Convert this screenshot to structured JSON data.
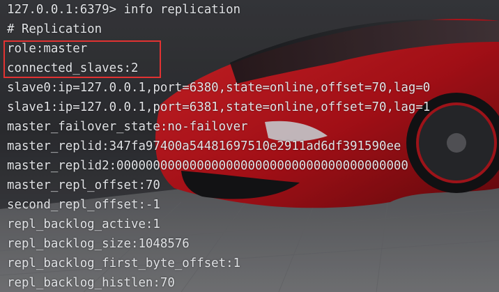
{
  "terminal": {
    "lines": [
      "127.0.0.1:6379> info replication",
      "# Replication",
      "role:master",
      "connected_slaves:2",
      "slave0:ip=127.0.0.1,port=6380,state=online,offset=70,lag=0",
      "slave1:ip=127.0.0.1,port=6381,state=online,offset=70,lag=1",
      "master_failover_state:no-failover",
      "master_replid:347fa97400a54481697510e2911ad6df391590ee",
      "master_replid2:0000000000000000000000000000000000000000",
      "master_repl_offset:70",
      "second_repl_offset:-1",
      "repl_backlog_active:1",
      "repl_backlog_size:1048576",
      "repl_backlog_first_byte_offset:1",
      "repl_backlog_histlen:70"
    ]
  },
  "colors": {
    "text": "#e1e3e6",
    "highlight_border": "#e23232",
    "background": "#3a3b3f",
    "car_red": "#c8151b"
  }
}
